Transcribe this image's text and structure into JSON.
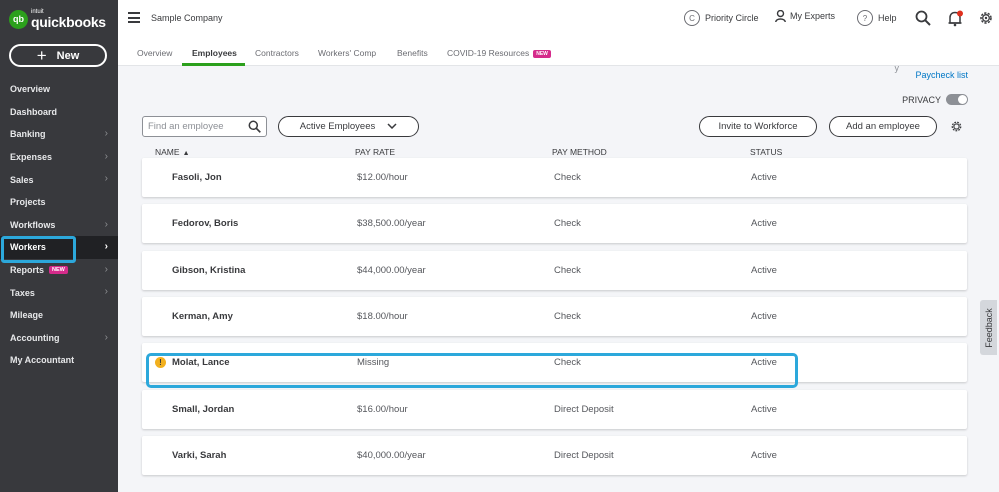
{
  "app": {
    "logo_brand": "intuit",
    "logo_name": "quickbooks",
    "logo_mark": "qb",
    "new_button": "New",
    "new_button_icon": "plus-icon"
  },
  "sidebar": {
    "items": [
      {
        "label": "Overview",
        "chevron": false,
        "badge": "",
        "active": false
      },
      {
        "label": "Dashboard",
        "chevron": false,
        "badge": "",
        "active": false
      },
      {
        "label": "Banking",
        "chevron": true,
        "badge": "",
        "active": false
      },
      {
        "label": "Expenses",
        "chevron": true,
        "badge": "",
        "active": false
      },
      {
        "label": "Sales",
        "chevron": true,
        "badge": "",
        "active": false
      },
      {
        "label": "Projects",
        "chevron": false,
        "badge": "",
        "active": false
      },
      {
        "label": "Workflows",
        "chevron": true,
        "badge": "",
        "active": false
      },
      {
        "label": "Workers",
        "chevron": true,
        "badge": "",
        "active": true
      },
      {
        "label": "Reports",
        "chevron": true,
        "badge": "NEW",
        "active": false
      },
      {
        "label": "Taxes",
        "chevron": true,
        "badge": "",
        "active": false
      },
      {
        "label": "Mileage",
        "chevron": false,
        "badge": "",
        "active": false
      },
      {
        "label": "Accounting",
        "chevron": true,
        "badge": "",
        "active": false
      },
      {
        "label": "My Accountant",
        "chevron": false,
        "badge": "",
        "active": false
      }
    ]
  },
  "header": {
    "company": "Sample Company",
    "priority_circle": "Priority Circle",
    "my_experts": "My Experts",
    "help": "Help",
    "help_icon_glyph": "?",
    "priority_icon_glyph": "C"
  },
  "tabs": [
    {
      "label": "Overview",
      "active": false,
      "badge": ""
    },
    {
      "label": "Employees",
      "active": true,
      "badge": ""
    },
    {
      "label": "Contractors",
      "active": false,
      "badge": ""
    },
    {
      "label": "Workers' Comp",
      "active": false,
      "badge": ""
    },
    {
      "label": "Benefits",
      "active": false,
      "badge": ""
    },
    {
      "label": "COVID-19 Resources",
      "active": false,
      "badge": "NEW"
    }
  ],
  "main": {
    "cut_off_text": "y",
    "paycheck_list": "Paycheck list",
    "privacy_label": "PRIVACY",
    "privacy_on": false,
    "search_placeholder": "Find an employee",
    "filter_value": "Active Employees",
    "invite_button": "Invite to Workforce",
    "add_button": "Add an employee",
    "warning_glyph": "!",
    "columns": {
      "name": "NAME",
      "sort_indicator": "▲",
      "pay_rate": "PAY RATE",
      "pay_method": "PAY METHOD",
      "status": "STATUS"
    },
    "employees": [
      {
        "name": "Fasoli, Jon",
        "pay_rate": "$12.00/hour",
        "pay_method": "Check",
        "status": "Active",
        "warning": false
      },
      {
        "name": "Fedorov, Boris",
        "pay_rate": "$38,500.00/year",
        "pay_method": "Check",
        "status": "Active",
        "warning": false
      },
      {
        "name": "Gibson, Kristina",
        "pay_rate": "$44,000.00/year",
        "pay_method": "Check",
        "status": "Active",
        "warning": false
      },
      {
        "name": "Kerman, Amy",
        "pay_rate": "$18.00/hour",
        "pay_method": "Check",
        "status": "Active",
        "warning": false
      },
      {
        "name": "Molat, Lance",
        "pay_rate": "Missing",
        "pay_method": "Check",
        "status": "Active",
        "warning": true
      },
      {
        "name": "Small, Jordan",
        "pay_rate": "$16.00/hour",
        "pay_method": "Direct Deposit",
        "status": "Active",
        "warning": false
      },
      {
        "name": "Varki, Sarah",
        "pay_rate": "$40,000.00/year",
        "pay_method": "Direct Deposit",
        "status": "Active",
        "warning": false
      }
    ],
    "feedback_label": "Feedback"
  },
  "colors": {
    "sidebar_bg": "#38393d",
    "brand_green": "#2ca01c",
    "highlight_blue": "#2ca8db",
    "link_blue": "#0077c5",
    "badge_pink": "#d52b8b",
    "warning_yellow": "#f2b01e"
  }
}
